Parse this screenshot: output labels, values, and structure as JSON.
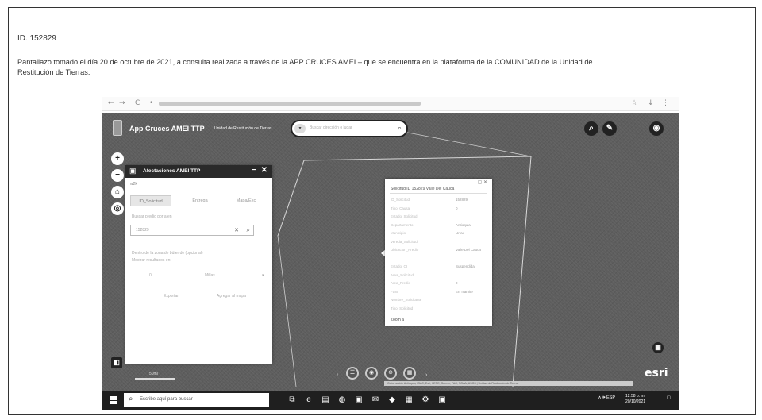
{
  "document": {
    "id_line": "ID. 152829",
    "caption_line1": "Pantallazo tomado el día 20 de octubre de 2021, a consulta realizada a través de la APP CRUCES AMEI – que se encuentra en la plataforma de la COMUNIDAD de la Unidad de",
    "caption_line2": "Restitución de Tierras."
  },
  "browser": {
    "nav_back": "←",
    "nav_forward": "→",
    "nav_reload": "C",
    "nav_lock": "•",
    "star_icon": "☆",
    "download_icon": "↓",
    "menu_icon": "⋮"
  },
  "app": {
    "title": "App Cruces AMEI TTP",
    "subtitle": "Unidad de Restitución de Tierras",
    "search_dropdown": "▾",
    "search_placeholder": "Buscar dirección o lugar",
    "search_icon": "⌕",
    "top_right": {
      "search": "⌕",
      "edit": "✎",
      "eye": "◉"
    },
    "left_controls": [
      "+",
      "−",
      "⌂",
      "◎"
    ]
  },
  "panel": {
    "title": "Afectaciones AMEI TTP",
    "sub": "w2k",
    "tabs": [
      "ID_Solicitud",
      "Entrega",
      "Mapa/Exc"
    ],
    "search_label": "Buscar predio por a en",
    "input_value": "152829",
    "desc1": "Dentro de la zona de búfer de (opcional)",
    "desc2": "Mostrar resultados en:",
    "value_num": "0",
    "unit_select": "Millas",
    "btn_left": "Exportar",
    "btn_right": "Agregar al mapa"
  },
  "popup": {
    "title": "Solicitud ID 152829 Valle Del Cauca",
    "rows": [
      {
        "label": "ID_Solicitud",
        "value": "152829"
      },
      {
        "label": "Tipo_Causa",
        "value": "0"
      },
      {
        "label": "Estado_Solicitud",
        "value": ""
      },
      {
        "label": "Departamento",
        "value": "Antioquia"
      },
      {
        "label": "Municipio",
        "value": "Urrao"
      },
      {
        "label": "Vereda_Solicitud",
        "value": ""
      },
      {
        "label": "Ubicacion_Predio",
        "value": "Valle Del Cauca"
      },
      {
        "label": "",
        "value": ""
      },
      {
        "label": "Estado_CI",
        "value": "Suspendida"
      },
      {
        "label": "Area_Solicitud",
        "value": ""
      },
      {
        "label": "Area_Predio",
        "value": "0"
      },
      {
        "label": "Fase",
        "value": "En Tramite"
      },
      {
        "label": "Nombre_Solicitante",
        "value": ""
      },
      {
        "label": "Tipo_Solicitud",
        "value": ""
      }
    ],
    "footer_link": "Zoom a",
    "header_icons": "▢ ✕"
  },
  "toolbar": {
    "left_arrow": "‹",
    "right_arrow": "›",
    "buttons": [
      "☰",
      "◉",
      "⊕",
      "▦"
    ]
  },
  "map": {
    "scale_label": "50mi",
    "attribution": "Gobernación Antioquia, IGAC, Esri, HERE, Garmin, FAO, NOAA, USGS | Unidad de Restitución de Tierras",
    "esri_logo": "esri",
    "corner_btn_left": "◧",
    "corner_btn_right": "▦"
  },
  "taskbar": {
    "search_placeholder": "Escribe aquí para buscar",
    "search_icon": "⌕",
    "apps": [
      "⧉",
      "e",
      "▤",
      "◍",
      "▣",
      "✉",
      "◆",
      "▦",
      "⚙",
      "▣"
    ],
    "tray": "∧ 🕪 ESP",
    "time": "12:58 p. m.",
    "date": "20/10/2021",
    "notif": "▢"
  }
}
